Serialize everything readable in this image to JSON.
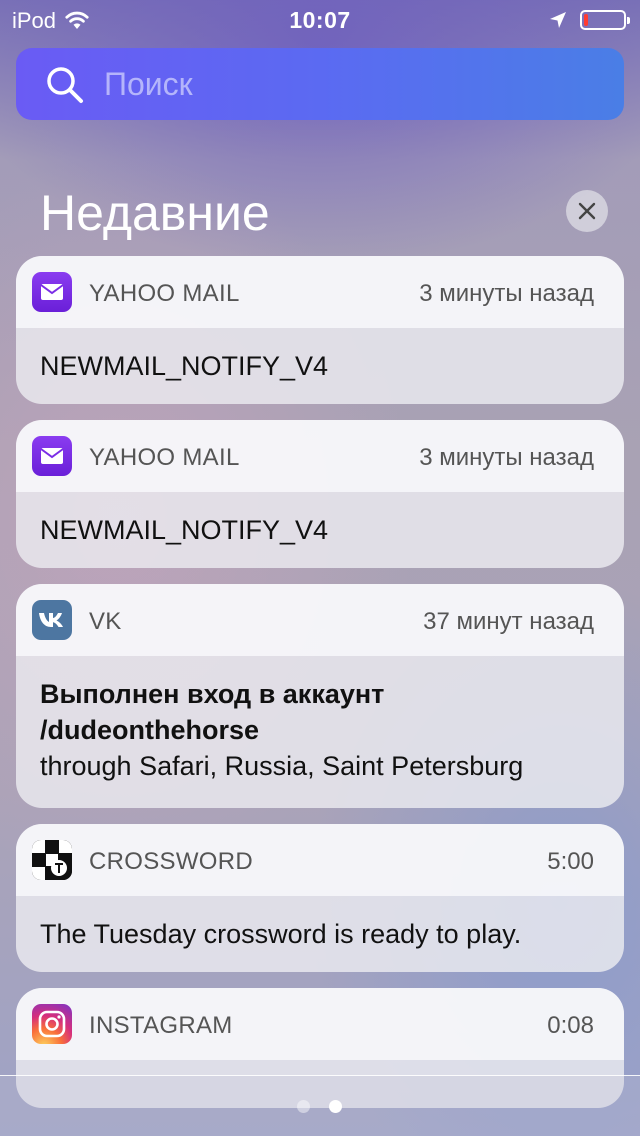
{
  "status": {
    "device": "iPod",
    "time": "10:07"
  },
  "search": {
    "placeholder": "Поиск"
  },
  "section": {
    "title": "Недавние"
  },
  "notifications": [
    {
      "app": "YAHOO MAIL",
      "time": "3 минуты назад",
      "title": "",
      "body": "NEWMAIL_NOTIFY_V4",
      "icon": "yahoo-mail-icon"
    },
    {
      "app": "YAHOO MAIL",
      "time": "3 минуты назад",
      "title": "",
      "body": "NEWMAIL_NOTIFY_V4",
      "icon": "yahoo-mail-icon"
    },
    {
      "app": "VK",
      "time": "37 минут назад",
      "title": "Выполнен вход в аккаунт /dudeonthehorse",
      "body": "through Safari, Russia, Saint Petersburg",
      "icon": "vk-icon"
    },
    {
      "app": "CROSSWORD",
      "time": "5:00",
      "title": "",
      "body": "The Tuesday crossword is ready to play.",
      "icon": "crossword-icon"
    },
    {
      "app": "INSTAGRAM",
      "time": "0:08",
      "title": "",
      "body": "",
      "icon": "instagram-icon"
    }
  ],
  "battery_level": 0.1,
  "colors": {
    "search_gradient_start": "#6a5bf4",
    "search_gradient_end": "#4a7ee6",
    "yahoo": "#7b2ee6",
    "vk": "#4d76a1",
    "battery_low": "#ff3b30"
  }
}
